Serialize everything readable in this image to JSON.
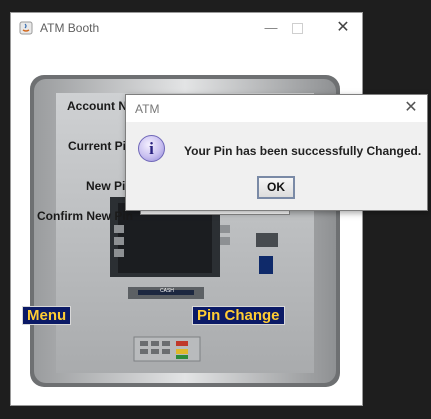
{
  "window": {
    "title": "ATM Booth",
    "minimize_label": "—",
    "close_label": "✕"
  },
  "form": {
    "account_label": "Account No",
    "current_pin_label": "Current Pin",
    "new_pin_label": "New Pin",
    "confirm_pin_label": "Confirm New Pin",
    "confirm_pin_value": "•••"
  },
  "atm": {
    "screen_text": "CASH"
  },
  "buttons": {
    "menu": "Menu",
    "pin_change": "Pin Change"
  },
  "dialog": {
    "title": "ATM",
    "message": "Your Pin has been successfully Changed.",
    "ok": "OK",
    "icon_glyph": "i",
    "close_label": "✕"
  },
  "colors": {
    "button_bg": "#0b1a66",
    "button_text": "#ffcc33"
  }
}
